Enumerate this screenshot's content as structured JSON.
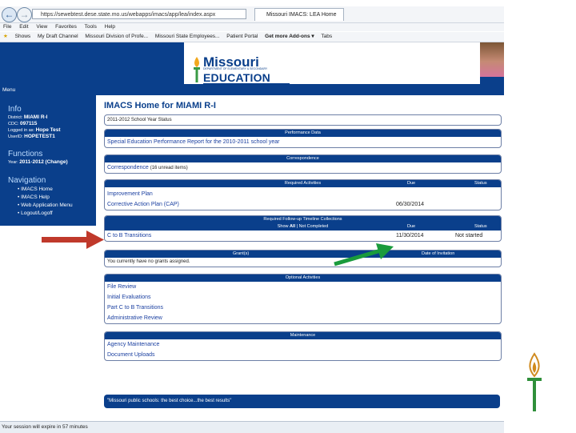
{
  "browser": {
    "url": "https://sewebtest.dese.state.mo.us/webapps/imacs/app/lea/index.aspx",
    "tab_title": "Missouri IMACS: LEA Home",
    "menu": [
      "File",
      "Edit",
      "View",
      "Favorites",
      "Tools",
      "Help"
    ],
    "favorites": [
      "Shows",
      "My Draft Channel",
      "Missouri Division of Profe...",
      "Missouri State Employees...",
      "Patient Portal",
      "Get more Add-ons ▾",
      "Tabs"
    ]
  },
  "header": {
    "logo_top": "Missouri",
    "logo_sub": "DEPARTMENT OF ELEMENTARY & SECONDARY",
    "logo_bottom": "EDUCATION",
    "menu_label": "Menu"
  },
  "sidebar": {
    "info_title": "Info",
    "district_label": "District:",
    "district_value": "MIAMI R-I",
    "cdc_label": "CDC:",
    "cdc_value": "097115",
    "logged_label": "Logged in as:",
    "logged_value": "Hope Test",
    "userid_label": "UserID:",
    "userid_value": "HOPETEST1",
    "functions_title": "Functions",
    "year_label": "Year:",
    "year_value": "2011-2012",
    "change_label": "(Change)",
    "nav_title": "Navigation",
    "nav_items": [
      "IMACS Home",
      "IMACS Help",
      "Web Application Menu",
      "Logout/Logoff"
    ]
  },
  "main": {
    "title": "IMACS Home for MIAMI R-I",
    "status_text": "2011-2012 School Year Status",
    "performance": {
      "header": "Performance Data",
      "link": "Special Education Performance Report for the 2010-2011 school year"
    },
    "correspondence": {
      "header": "Correspondence",
      "link": "Correspondence",
      "note": "(16 unread items)"
    },
    "required": {
      "header": "Required Activities",
      "due_header": "Due",
      "status_header": "Status",
      "rows": [
        {
          "name": "Improvement Plan",
          "due": "",
          "status": ""
        },
        {
          "name": "Corrective Action Plan (CAP)",
          "due": "06/30/2014",
          "status": ""
        }
      ]
    },
    "followup": {
      "header": "Required Follow-up Timeline Collections",
      "filter_show": "Show",
      "filter_all": "All",
      "filter_sep": "|",
      "filter_not": "Not Completed",
      "due_header": "Due",
      "status_header": "Status",
      "rows": [
        {
          "name": "C to B Transitions",
          "due": "11/30/2014",
          "status": "Not started"
        }
      ]
    },
    "grants": {
      "header": "Grant(s)",
      "date_header": "Date of Invitation",
      "text": "You currently have no grants assigned."
    },
    "optional": {
      "header": "Optional Activities",
      "links": [
        "File Review",
        "Initial Evaluations",
        "Part C to B Transitions",
        "Administrative Review"
      ]
    },
    "maintenance": {
      "header": "Maintenance",
      "links": [
        "Agency Maintenance",
        "Document Uploads"
      ]
    },
    "tagline": "\"Missouri public schools: the best choice...the best results\""
  },
  "status_bar": {
    "text": "Your session will expire in 57 minutes"
  },
  "colors": {
    "brand_blue": "#0a3f8b",
    "arrow_red": "#c0392b",
    "arrow_green": "#1a9b3c"
  }
}
